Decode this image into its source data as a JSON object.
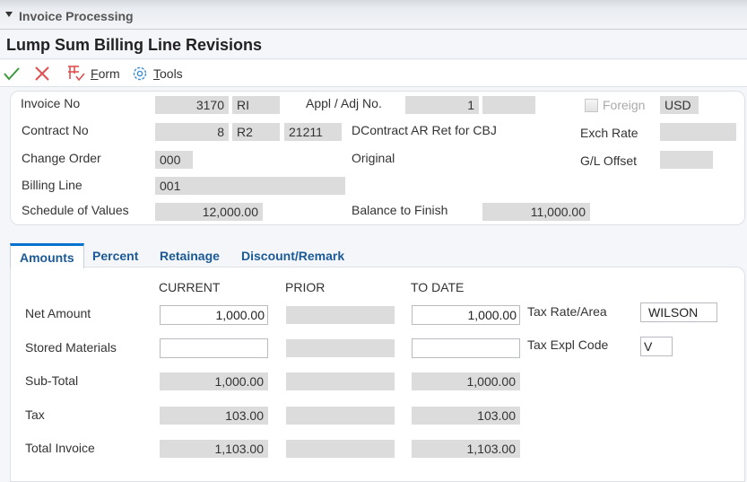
{
  "app": {
    "title": "Invoice Processing"
  },
  "page": {
    "title": "Lump Sum Billing Line Revisions"
  },
  "toolbar": {
    "ok_icon": "checkmark-icon",
    "cancel_icon": "x-icon",
    "form_label_u": "F",
    "form_label_rest": "orm",
    "tools_label_u": "T",
    "tools_label_rest": "ools",
    "colors": {
      "ok": "#3c9a3c",
      "cancel": "#e05050",
      "form": "#e05050",
      "tools": "#3b8fd6"
    }
  },
  "header": {
    "invoice_no": {
      "label": "Invoice No",
      "number": "3170",
      "type": "RI"
    },
    "appl_adj_no": {
      "label": "Appl / Adj No.",
      "value": "1",
      "extra": ""
    },
    "foreign": {
      "label": "Foreign",
      "checked": false,
      "currency": "USD"
    },
    "contract_no": {
      "label": "Contract No",
      "number": "8",
      "type": "R2",
      "company": "21211",
      "description": "DContract AR Ret for CBJ"
    },
    "exch_rate": {
      "label": "Exch Rate",
      "value": ""
    },
    "change_order": {
      "label": "Change Order",
      "value": "000",
      "description": "Original"
    },
    "gl_offset": {
      "label": "G/L Offset",
      "value": ""
    },
    "billing_line": {
      "label": "Billing Line",
      "value": "001"
    },
    "schedule_of_values": {
      "label": "Schedule of Values",
      "value": "12,000.00"
    },
    "balance_to_finish": {
      "label": "Balance to Finish",
      "value": "11,000.00"
    }
  },
  "tabs": [
    {
      "label": "Amounts",
      "active": true
    },
    {
      "label": "Percent",
      "active": false
    },
    {
      "label": "Retainage",
      "active": false
    },
    {
      "label": "Discount/Remark",
      "active": false
    }
  ],
  "amounts": {
    "columns": [
      "CURRENT",
      "PRIOR",
      "TO DATE"
    ],
    "rows": [
      {
        "label": "Net Amount",
        "current": "1,000.00",
        "prior": "",
        "to_date": "1,000.00"
      },
      {
        "label": "Stored Materials",
        "current": "",
        "prior": "",
        "to_date": ""
      },
      {
        "label": "Sub-Total",
        "current": "1,000.00",
        "prior": "",
        "to_date": "1,000.00"
      },
      {
        "label": "Tax",
        "current": "103.00",
        "prior": "",
        "to_date": "103.00"
      },
      {
        "label": "Total Invoice",
        "current": "1,103.00",
        "prior": "",
        "to_date": "1,103.00"
      }
    ],
    "tax_rate_area": {
      "label": "Tax Rate/Area",
      "value": "WILSON"
    },
    "tax_expl_code": {
      "label": "Tax Expl Code",
      "value": "V"
    }
  }
}
